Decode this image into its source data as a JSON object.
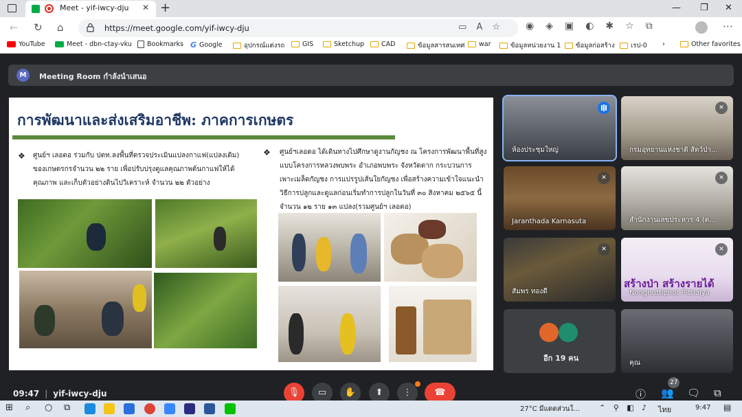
{
  "browser": {
    "tab_title": "Meet - yif-iwcy-dju",
    "url": "https://meet.google.com/yif-iwcy-dju",
    "bookmarks": [
      {
        "label": "YouTube",
        "icon": "youtube-icon"
      },
      {
        "label": "Meet - dbn-ctay-vku",
        "icon": "meet-icon"
      },
      {
        "label": "Bookmarks",
        "icon": "bookmark-page-icon"
      },
      {
        "label": "Google",
        "icon": "google-icon"
      },
      {
        "label": "อุปกรณ์แต่งรถ",
        "icon": "folder-icon"
      },
      {
        "label": "GIS",
        "icon": "folder-icon"
      },
      {
        "label": "Sketchup",
        "icon": "folder-icon"
      },
      {
        "label": "CAD",
        "icon": "folder-icon"
      },
      {
        "label": "ข้อมูลสารสนเทศ",
        "icon": "folder-icon"
      },
      {
        "label": "war",
        "icon": "folder-icon"
      },
      {
        "label": "ข้อมูลหน่วยงาน 1",
        "icon": "folder-icon"
      },
      {
        "label": "ข้อมูลก่อสร้าง",
        "icon": "folder-icon"
      },
      {
        "label": "เรป-0",
        "icon": "folder-icon"
      }
    ],
    "other_favorites": "Other favorites"
  },
  "meeting": {
    "room_initial": "M",
    "room_title": "Meeting Room กำลังนำเสนอ",
    "clock": "09:47",
    "code": "yif-iwcy-dju",
    "participant_count": "27"
  },
  "slide": {
    "title": "การพัฒนาและส่งเสริมอาชีพ: ภาคการเกษตร",
    "bullet_left": [
      "ศูนย์ฯ เลอตอ ร่วมกับ ปตท.ลงพื้นที่ตรวจประเมินแปลงกาแฟ(แปลงเดิม)",
      "ของเกษตรกรจำนวน  ๒๒ ราย เพื่อปรับปรุงดูแลคุณภาพต้นกาแฟให้ได้",
      "คุณภาพ และเก็บตัวอย่างดินไปวิเคราะห์ จำนวน  ๒๒  ตัวอย่าง"
    ],
    "bullet_right": [
      "ศูนย์ฯเลอตอ ได้เดินทางไปศึกษาดูงานกัญชง ณ โครงการพัฒนาพื้นที่สูง",
      "แบบโครงการหลวงพบพระ อำเภอพบพระ จังหวัดตาก กระบวนการ",
      "เพาะเมล็ดกัญชง การแปรรูปเส้นใยกัญชง เพื่อสร้างความเข้าใจแนะนำ",
      "วิธีการปลูกและดูแลก่อนเริ่มทำการปลูกในวันที่ ๓๐ สิงหาคม ๒๕๖๕ นี้",
      "จำนวน ๑๒ ราย ๑๓ แปลง(รวมศูนย์ฯ เลอตอ)"
    ]
  },
  "tiles": [
    {
      "name": "ห้องประชุมใหญ่",
      "state": "speaking"
    },
    {
      "name": "กรมอุทยานแห่งชาติ สัตว์ป่า...",
      "state": "muted"
    },
    {
      "name": "Jaranthada Karnasuta",
      "state": "muted"
    },
    {
      "name": "สำนักงานเลขประหาร 4 (ต...",
      "state": "muted"
    },
    {
      "name": "สัมพร ทองดี",
      "state": "muted"
    },
    {
      "name": "Nongnuttiphat Pichaiya",
      "state": "muted"
    },
    {
      "name": "อีก 19 คน",
      "state": "others"
    },
    {
      "name": "คุณ",
      "state": "self"
    }
  ],
  "banner_text": "สร้างป่า สร้างรายได้",
  "taskbar": {
    "weather": "27°C  มีแดดส่วนใ...",
    "language": "ไทย",
    "time": "9:47"
  },
  "colors": {
    "meet_bg": "#202124",
    "slide_title": "#1f3864",
    "rule_green": "#5b8a3c",
    "end_call_red": "#ea4335",
    "speaking_blue": "#1a73e8"
  }
}
